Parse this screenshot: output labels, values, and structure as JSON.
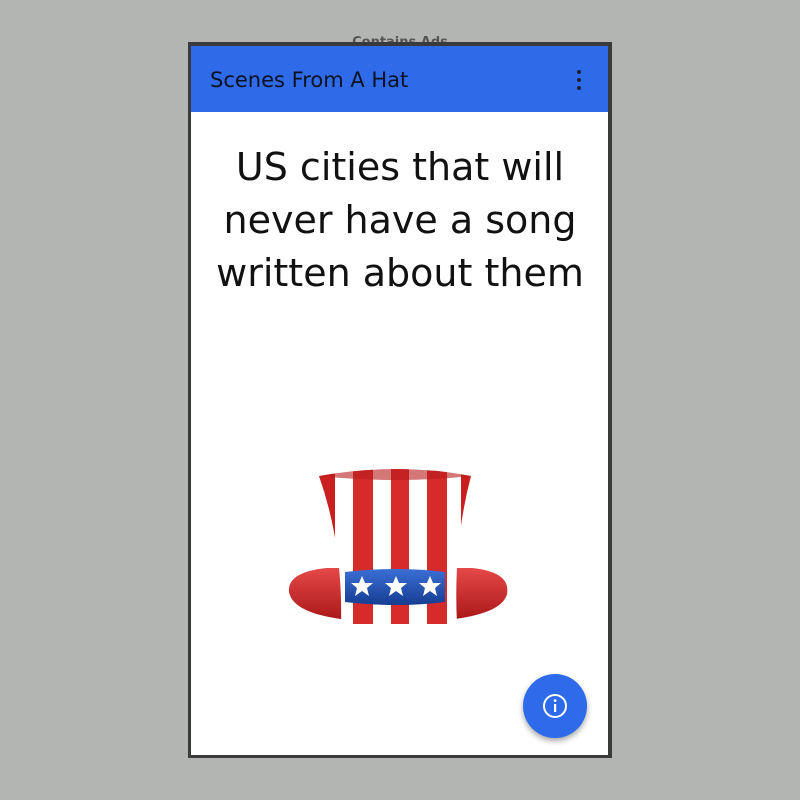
{
  "app": {
    "title": "Scenes From A Hat",
    "background_peek_text": "Contains Ads"
  },
  "prompt": {
    "text": "US cities that will never have a song written about them"
  },
  "icons": {
    "menu": "more-vert-icon",
    "info": "info-icon",
    "hat": "uncle-sam-hat-icon"
  },
  "colors": {
    "app_bar": "#2f6ae8",
    "fab": "#2e6bea",
    "hat_red": "#d32a2a",
    "hat_blue": "#1e4fb0"
  }
}
